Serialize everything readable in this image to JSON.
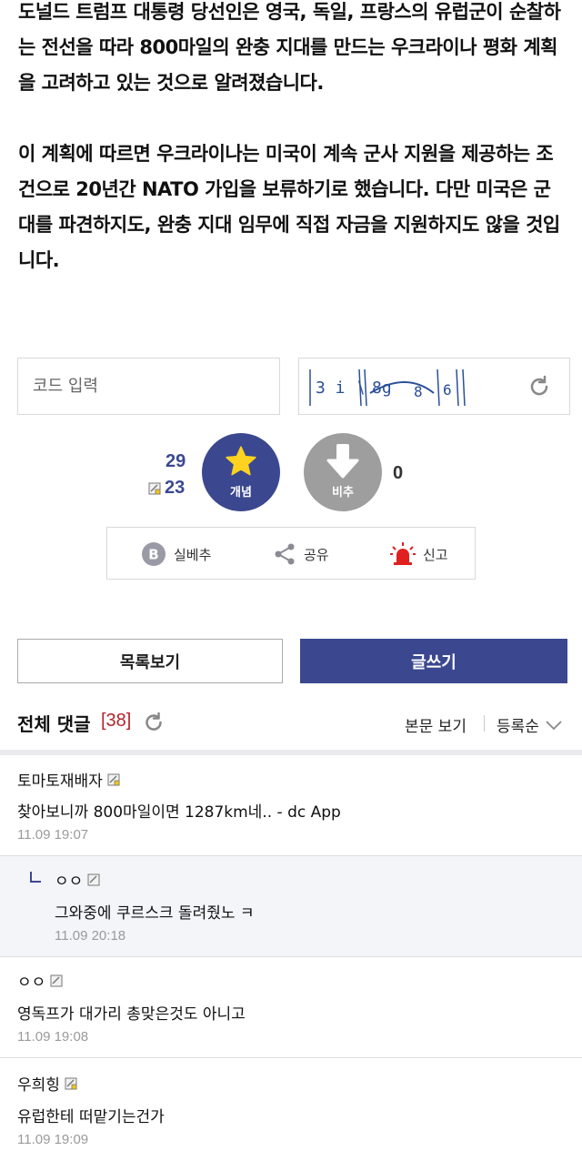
{
  "article": {
    "paragraph1": "도널드 트럼프 대통령 당선인은 영국, 독일, 프랑스의 유럽군이 순찰하는 전선을 따라 800마일의 완충 지대를 만드는 우크라이나 평화 계획을 고려하고 있는 것으로 알려졌습니다.",
    "paragraph2": "이 계획에 따르면 우크라이나는 미국이 계속 군사 지원을 제공하는 조건으로 20년간 NATO 가입을 보류하기로 했습니다. 다만 미국은 군대를 파견하지도, 완충 지대 임무에 직접 자금을 지원하지도 않을 것입니다."
  },
  "captcha": {
    "input_placeholder": "코드 입력",
    "refresh_icon": "refresh-icon"
  },
  "vote": {
    "up_count": "29",
    "fixed_count": "23",
    "up_label": "개념",
    "down_label": "비추",
    "down_count": "0",
    "accent": "#3b4890"
  },
  "actions": {
    "best_label": "실베추",
    "share_label": "공유",
    "report_label": "신고"
  },
  "buttons": {
    "list_label": "목록보기",
    "write_label": "글쓰기"
  },
  "comment_header": {
    "title": "전체 댓글",
    "count": "[38]",
    "view_label": "본문 보기",
    "sort_label": "등록순"
  },
  "comments": [
    {
      "author": "토마토재배자",
      "text": "찾아보니까 800마일이면 1287km네.. - dc App",
      "date": "11.09 19:07",
      "reply": false
    },
    {
      "author": "ㅇㅇ",
      "text": "그와중에 쿠르스크 돌려줬노 ㅋ",
      "date": "11.09 20:18",
      "reply": true
    },
    {
      "author": "ㅇㅇ",
      "text": "영독프가 대가리 총맞은것도 아니고",
      "date": "11.09 19:08",
      "reply": false
    },
    {
      "author": "우희힝",
      "text": "유럽한테 떠맡기는건가",
      "date": "11.09 19:09",
      "reply": false
    }
  ]
}
